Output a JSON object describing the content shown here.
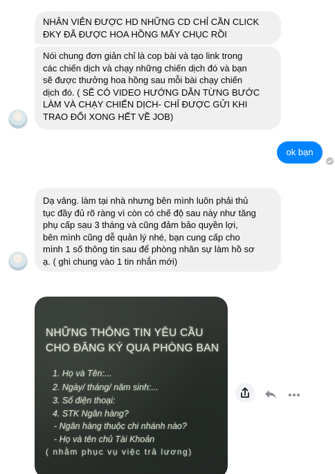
{
  "messages": {
    "m1": {
      "sender": "other",
      "lines": [
        "NHÂN VIÊN ĐƯỢC HD NHỮNG CD CHỈ CẦN CLICK",
        "ĐKY ĐÃ ĐƯỢC HOA HỒNG MẤY CHỤC RỒI"
      ]
    },
    "m2": {
      "sender": "other",
      "lines": [
        "Nói chung đơn giản chỉ là cop bài và tạo link trong",
        "các chiến dịch và chạy những chiến dịch đó  và bạn",
        "sẽ được thưởng hoa hồng sau mỗi bài chạy chiến",
        "dịch đó.  ( SẼ CÓ VIDEO HƯỚNG DẪN TỪNG BƯỚC",
        "LÀM VÀ CHẠY CHIẾN DỊCH- CHỈ ĐƯỢC GỬI KHI",
        "TRAO ĐỔI XONG HẾT VỀ JOB)"
      ]
    },
    "sent": {
      "sender": "me",
      "text": "ok bạn"
    },
    "m3": {
      "sender": "other",
      "lines": [
        "Dạ vâng. làm tại nhà nhưng bên mình luôn phải thủ",
        "tục đầy đủ rõ ràng vì còn có chế độ sau này như tăng",
        "phụ cấp  sau 3 tháng và cũng đảm bảo quyền lợi,",
        "bên mình cũng dễ quản lý nhé, bạn cung cấp cho",
        "mình 1 số thông tin sau để phòng nhân sự làm hồ sơ",
        "ạ. ( ghi chung vào 1 tin nhắn mới)"
      ]
    }
  },
  "image_message": {
    "title_lines": [
      "NHỮNG THÔNG TIN YÊU CẦU",
      "CHO ĐĂNG KÝ QUA PHÒNG BAN"
    ],
    "items": [
      "1.  Họ và Tên:...",
      "2.  Ngày/ tháng/ năm sinh:...",
      "3.  Số điện thoại:",
      "4.  STK Ngân hàng?",
      "-   Ngân hàng thuộc chi nhánh nào?",
      "-   Họ và tên chủ Tài Khoản"
    ],
    "note": "( nhằm phục vụ việc trả lương)"
  },
  "actions": {
    "share_icon": "share-icon",
    "reply_icon": "reply-icon",
    "more_icon": "more-dots-icon"
  },
  "colors": {
    "sent_bubble": "#0084ff",
    "received_bubble": "#f0f0f0",
    "image_bg": "#2f3430"
  }
}
